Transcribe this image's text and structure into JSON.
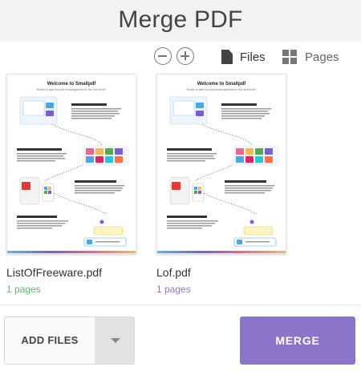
{
  "header": {
    "title": "Merge PDF"
  },
  "toolbar": {
    "zoom_out_icon": "zoom-out-icon",
    "zoom_in_icon": "zoom-in-icon",
    "view_files_label": "Files",
    "view_pages_label": "Pages"
  },
  "colors": {
    "merge_button": "#8b75c8",
    "page_count_green": "#5fb96d",
    "page_count_purple": "#8b75c8"
  },
  "files": [
    {
      "name": "ListOfFreeware.pdf",
      "pages": "1 pages",
      "thumbnail": {
        "title": "Welcome to Smallpdf",
        "subtitle": "Ready to take document management to the next level?"
      }
    },
    {
      "name": "Lof.pdf",
      "pages": "1 pages",
      "thumbnail": {
        "title": "Welcome to Smallpdf",
        "subtitle": "Ready to take document management to the next level?"
      }
    }
  ],
  "actions": {
    "add_files_label": "ADD FILES",
    "merge_label": "MERGE"
  }
}
